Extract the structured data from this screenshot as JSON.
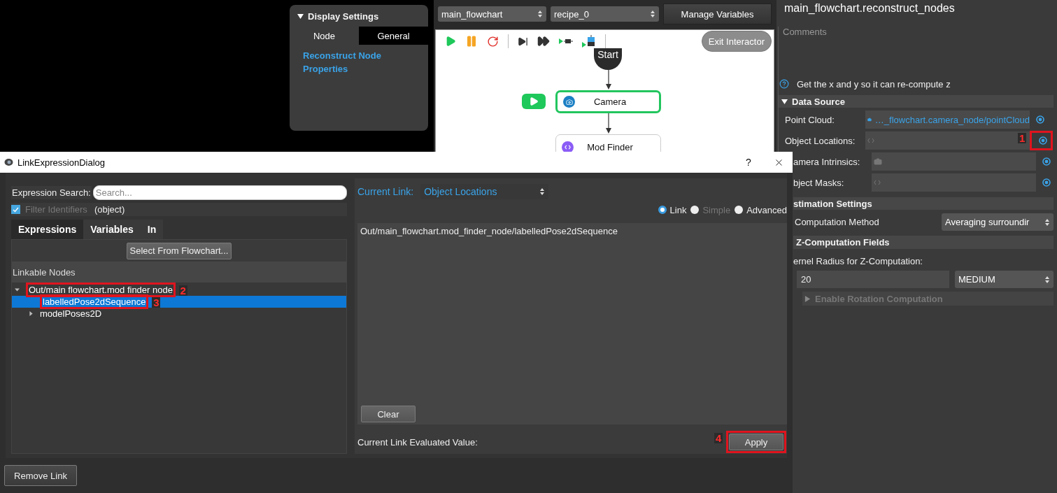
{
  "display_settings": {
    "title": "Display Settings",
    "expanded": true,
    "tabs": [
      {
        "label": "Node",
        "selected": false
      },
      {
        "label": "General",
        "selected": true
      }
    ],
    "heading": "Reconstruct Node Properties"
  },
  "selectors": [
    {
      "value": "main_flowchart"
    },
    {
      "value": "recipe_0"
    }
  ],
  "manage_button": "Manage Variables",
  "flowchart": {
    "exit_button": "Exit Interactor",
    "nodes": [
      {
        "kind": "start",
        "label": "Start",
        "selected": false
      },
      {
        "kind": "camera",
        "label": "Camera",
        "selected": true
      },
      {
        "kind": "module",
        "label": "Mod Finder",
        "selected": false
      }
    ]
  },
  "node_properties": {
    "title": "main_flowchart.reconstruct_nodes",
    "comments_label": "Comments",
    "description": "Get the x and y so it can re-compute z",
    "data_source": {
      "title": "Data Source",
      "expanded": true,
      "rows": [
        {
          "label": "Point Cloud:",
          "kind": "camera",
          "value": "…_flowchart.camera_node/pointCloud"
        },
        {
          "label": "Object Locations:",
          "kind": "code",
          "callout": "1"
        },
        {
          "label": "amera Intrinsics:",
          "kind": "camera"
        },
        {
          "label": "bject Masks:",
          "kind": "code"
        }
      ]
    },
    "estimation": {
      "title": "stimation Settings",
      "method_label": "Computation Method",
      "method_value": "Averaging surroundir"
    },
    "z_fields": {
      "title": "Z-Computation Fields",
      "kernel_label": "ernel Radius for Z-Computation:",
      "kernel_value": "20",
      "kernel_size": "MEDIUM"
    },
    "rotation": {
      "title": "Enable Rotation Computation",
      "expanded": false,
      "disabled": true
    }
  },
  "dialog": {
    "title": "LinkExpressionDialog",
    "help": "?",
    "search_label": "Expression Search:",
    "search_placeholder": "Search...",
    "filter": {
      "label": "Filter Identifiers",
      "checked": true,
      "value": "(object)"
    },
    "tabs": [
      {
        "label": "Expressions",
        "selected": true
      },
      {
        "label": "Variables",
        "selected": false
      },
      {
        "label": "In",
        "selected": false
      }
    ],
    "select_button": "Select From Flowchart...",
    "tree_title": "Linkable Nodes",
    "tree": [
      {
        "label": "Out/main flowchart.mod finder node",
        "selected": false,
        "expanded": true,
        "callout": "2",
        "children": [
          {
            "label": "labelledPose2dSequence",
            "selected": true,
            "callout": "3"
          },
          {
            "label": "modelPoses2D",
            "selected": false,
            "expanded": false
          }
        ]
      }
    ],
    "current_link": {
      "label": "Current Link:",
      "value": "Object Locations"
    },
    "modes": [
      {
        "label": "Link",
        "selected": true,
        "disabled": false
      },
      {
        "label": "Simple",
        "selected": false,
        "disabled": true
      },
      {
        "label": "Advanced",
        "selected": false,
        "disabled": false
      }
    ],
    "expression": "Out/main_flowchart.mod_finder_node/labelledPose2dSequence",
    "clear_button": "Clear",
    "evaluated_label": "Current Link Evaluated Value:",
    "apply_button": {
      "label": "Apply",
      "callout": "4"
    },
    "remove_button": "Remove Link"
  }
}
